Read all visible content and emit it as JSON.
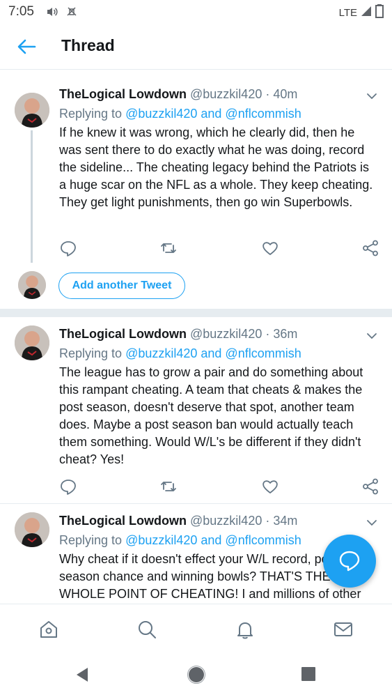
{
  "status_bar": {
    "time": "7:05",
    "network": "LTE"
  },
  "header": {
    "title": "Thread"
  },
  "tweets": [
    {
      "name": "TheLogical Lowdown",
      "meta": "@buzzkil420 · 40m",
      "replying_prefix": "Replying to ",
      "replying_mentions": "@buzzkil420 and @nflcommish",
      "text": "If he knew it was wrong, which he clearly did, then he was sent there to do exactly what he was doing, record the sideline...  The cheating legacy behind the Patriots is a huge scar on the NFL as a whole. They keep cheating. They get light punishments, then go win Superbowls."
    },
    {
      "name": "TheLogical Lowdown",
      "meta": "@buzzkil420 · 36m",
      "replying_prefix": "Replying to ",
      "replying_mentions": "@buzzkil420 and @nflcommish",
      "text": "The league has to grow a pair and do something about this rampant cheating. A team that cheats & makes the post season, doesn't deserve that spot, another team does. Maybe a post season ban would actually teach them something. Would W/L's be different if they didn't cheat? Yes!"
    },
    {
      "name": "TheLogical Lowdown",
      "meta": "@buzzkil420 · 34m",
      "replying_prefix": "Replying to ",
      "replying_mentions": "@buzzkil420 and @nflcommish",
      "text": "Why cheat if it doesn't effect your W/L record, post season chance and winning bowls? THAT'S THE WHOLE POINT OF CHEATING! I and millions of other"
    }
  ],
  "add_tweet": {
    "label": "Add another Tweet"
  },
  "colors": {
    "accent": "#1da1f2",
    "text": "#14171a",
    "muted": "#657786",
    "border": "#e6ecf0"
  },
  "icons": {
    "back": "arrow-left-icon",
    "reply": "reply-icon",
    "retweet": "retweet-icon",
    "like": "heart-icon",
    "share": "share-icon",
    "caret": "chevron-down-icon",
    "fab": "compose-reply-icon",
    "nav_home": "home-icon",
    "nav_search": "search-icon",
    "nav_notifications": "bell-icon",
    "nav_messages": "mail-icon"
  }
}
